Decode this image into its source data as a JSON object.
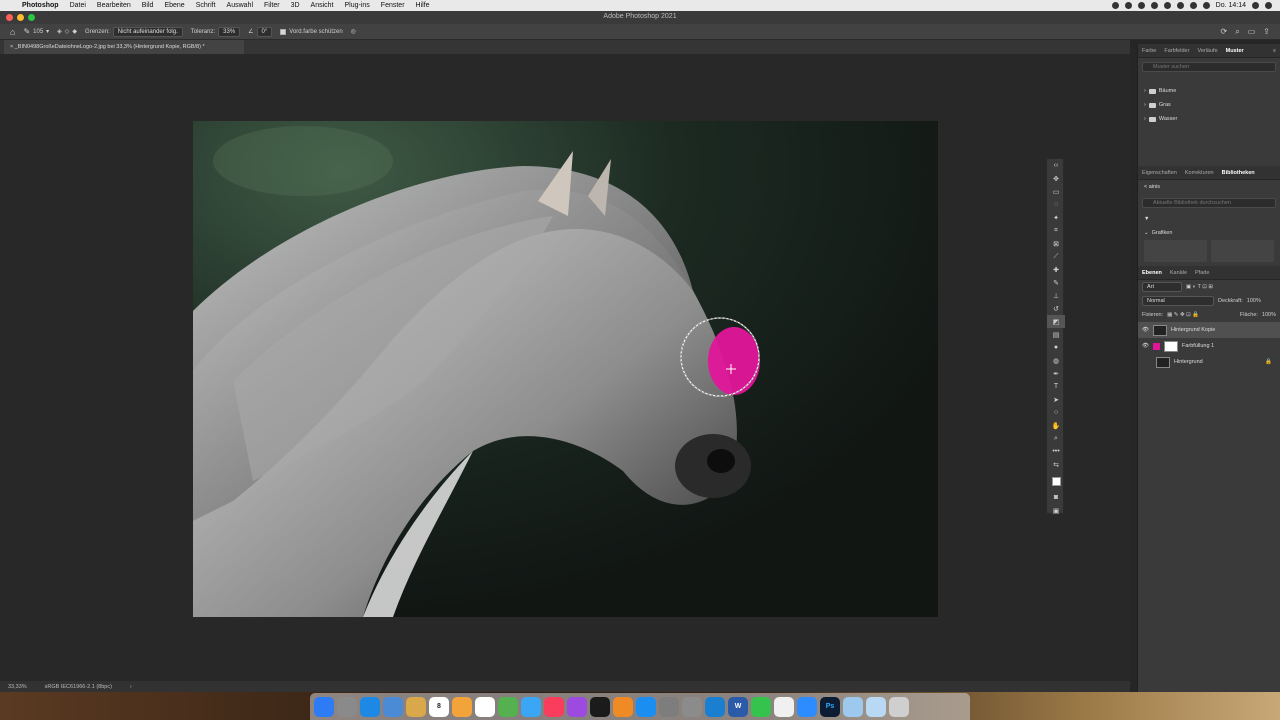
{
  "menubar": {
    "apple_glyph": "",
    "items": [
      "Photoshop",
      "Datei",
      "Bearbeiten",
      "Bild",
      "Ebene",
      "Schrift",
      "Auswahl",
      "Filter",
      "3D",
      "Ansicht",
      "Plug-ins",
      "Fenster",
      "Hilfe"
    ],
    "clock": "Do. 14:14"
  },
  "window": {
    "title": "Adobe Photoshop 2021"
  },
  "options": {
    "brush_size": "105",
    "limits_label": "Grenzen:",
    "limits_value": "Nicht aufeinander folg.",
    "tolerance_label": "Toleranz:",
    "tolerance_value": "33%",
    "angle_value": "0°",
    "protect_label": "Vord.farbe schützen"
  },
  "document": {
    "tab_title": "_BIN0498GroßeDateiohneLogo-2.jpg bei 33,3% (Hintergrund Kopie, RGB/8) *"
  },
  "status": {
    "zoom": "33,33%",
    "profile": "sRGB IEC61966-2.1 (8bpc)"
  },
  "panels": {
    "top_tabs": [
      "Farbe",
      "Farbfelder",
      "Verläufe",
      "Muster"
    ],
    "top_active": 3,
    "muster_search": "Muster suchen",
    "folders": [
      "Bäume",
      "Gras",
      "Wasser"
    ],
    "mid_tabs": [
      "Eigenschaften",
      "Korrekturen",
      "Bibliotheken"
    ],
    "mid_active": 2,
    "library_back": "< ainis",
    "library_search": "Aktuelle Bibliothek durchsuchen",
    "library_section": "Grafiken",
    "layers_tabs": [
      "Ebenen",
      "Kanäle",
      "Pfade"
    ],
    "layers_active": 0,
    "filter_kind": "Art",
    "blend_mode": "Normal",
    "opacity_label": "Deckkraft:",
    "opacity_value": "100%",
    "lock_label": "Fixieren:",
    "fill_label": "Fläche:",
    "fill_value": "100%",
    "layers": [
      {
        "name": "Hintergrund Kopie",
        "visible": true,
        "selected": true
      },
      {
        "name": "Farbfüllung 1",
        "visible": true,
        "selected": false
      },
      {
        "name": "Hintergrund",
        "visible": false,
        "selected": false
      }
    ]
  },
  "colors": {
    "accent_magenta": "#e0169a",
    "panel_bg": "#3a3a3a",
    "canvas_bg": "#282828"
  },
  "dock": {
    "apps": [
      {
        "icon": "finder-icon",
        "color": "#2d7cf6"
      },
      {
        "icon": "launchpad-icon",
        "color": "#8a8a8a"
      },
      {
        "icon": "safari-icon",
        "color": "#1e88e5"
      },
      {
        "icon": "preview-icon",
        "color": "#4b8bd6"
      },
      {
        "icon": "notes-icon",
        "color": "#d9a84a"
      },
      {
        "icon": "calendar-icon",
        "color": "#ffffff"
      },
      {
        "icon": "photos-icon",
        "color": "#f2a33a"
      },
      {
        "icon": "reminders-icon",
        "color": "#ffffff"
      },
      {
        "icon": "maps-icon",
        "color": "#55b04f"
      },
      {
        "icon": "messages-icon",
        "color": "#3aa6f5"
      },
      {
        "icon": "music-icon",
        "color": "#fb3d5d"
      },
      {
        "icon": "podcasts-icon",
        "color": "#9c4adf"
      },
      {
        "icon": "tv-icon",
        "color": "#1b1b1b"
      },
      {
        "icon": "books-icon",
        "color": "#ef8a25"
      },
      {
        "icon": "app-store-icon",
        "color": "#1b8ef2"
      },
      {
        "icon": "preferences-icon",
        "color": "#7d7d7d"
      },
      {
        "icon": "settings-icon",
        "color": "#8b8b8b"
      },
      {
        "icon": "edge-icon",
        "color": "#1a7fd0"
      },
      {
        "icon": "word-icon",
        "color": "#2a5aa8"
      },
      {
        "icon": "whatsapp-icon",
        "color": "#35c24d"
      },
      {
        "icon": "document-icon",
        "color": "#f0f0f0"
      },
      {
        "icon": "zoom-icon",
        "color": "#2d8cff"
      },
      {
        "icon": "photoshop-icon",
        "color": "#0b1c33"
      },
      {
        "icon": "folder-icon",
        "color": "#9ec9ef"
      },
      {
        "icon": "downloads-icon",
        "color": "#b9d8f4"
      },
      {
        "icon": "trash-icon",
        "color": "#cfcfcf"
      }
    ],
    "calendar_day": "8",
    "photoshop_label": "Ps",
    "word_label": "W"
  }
}
